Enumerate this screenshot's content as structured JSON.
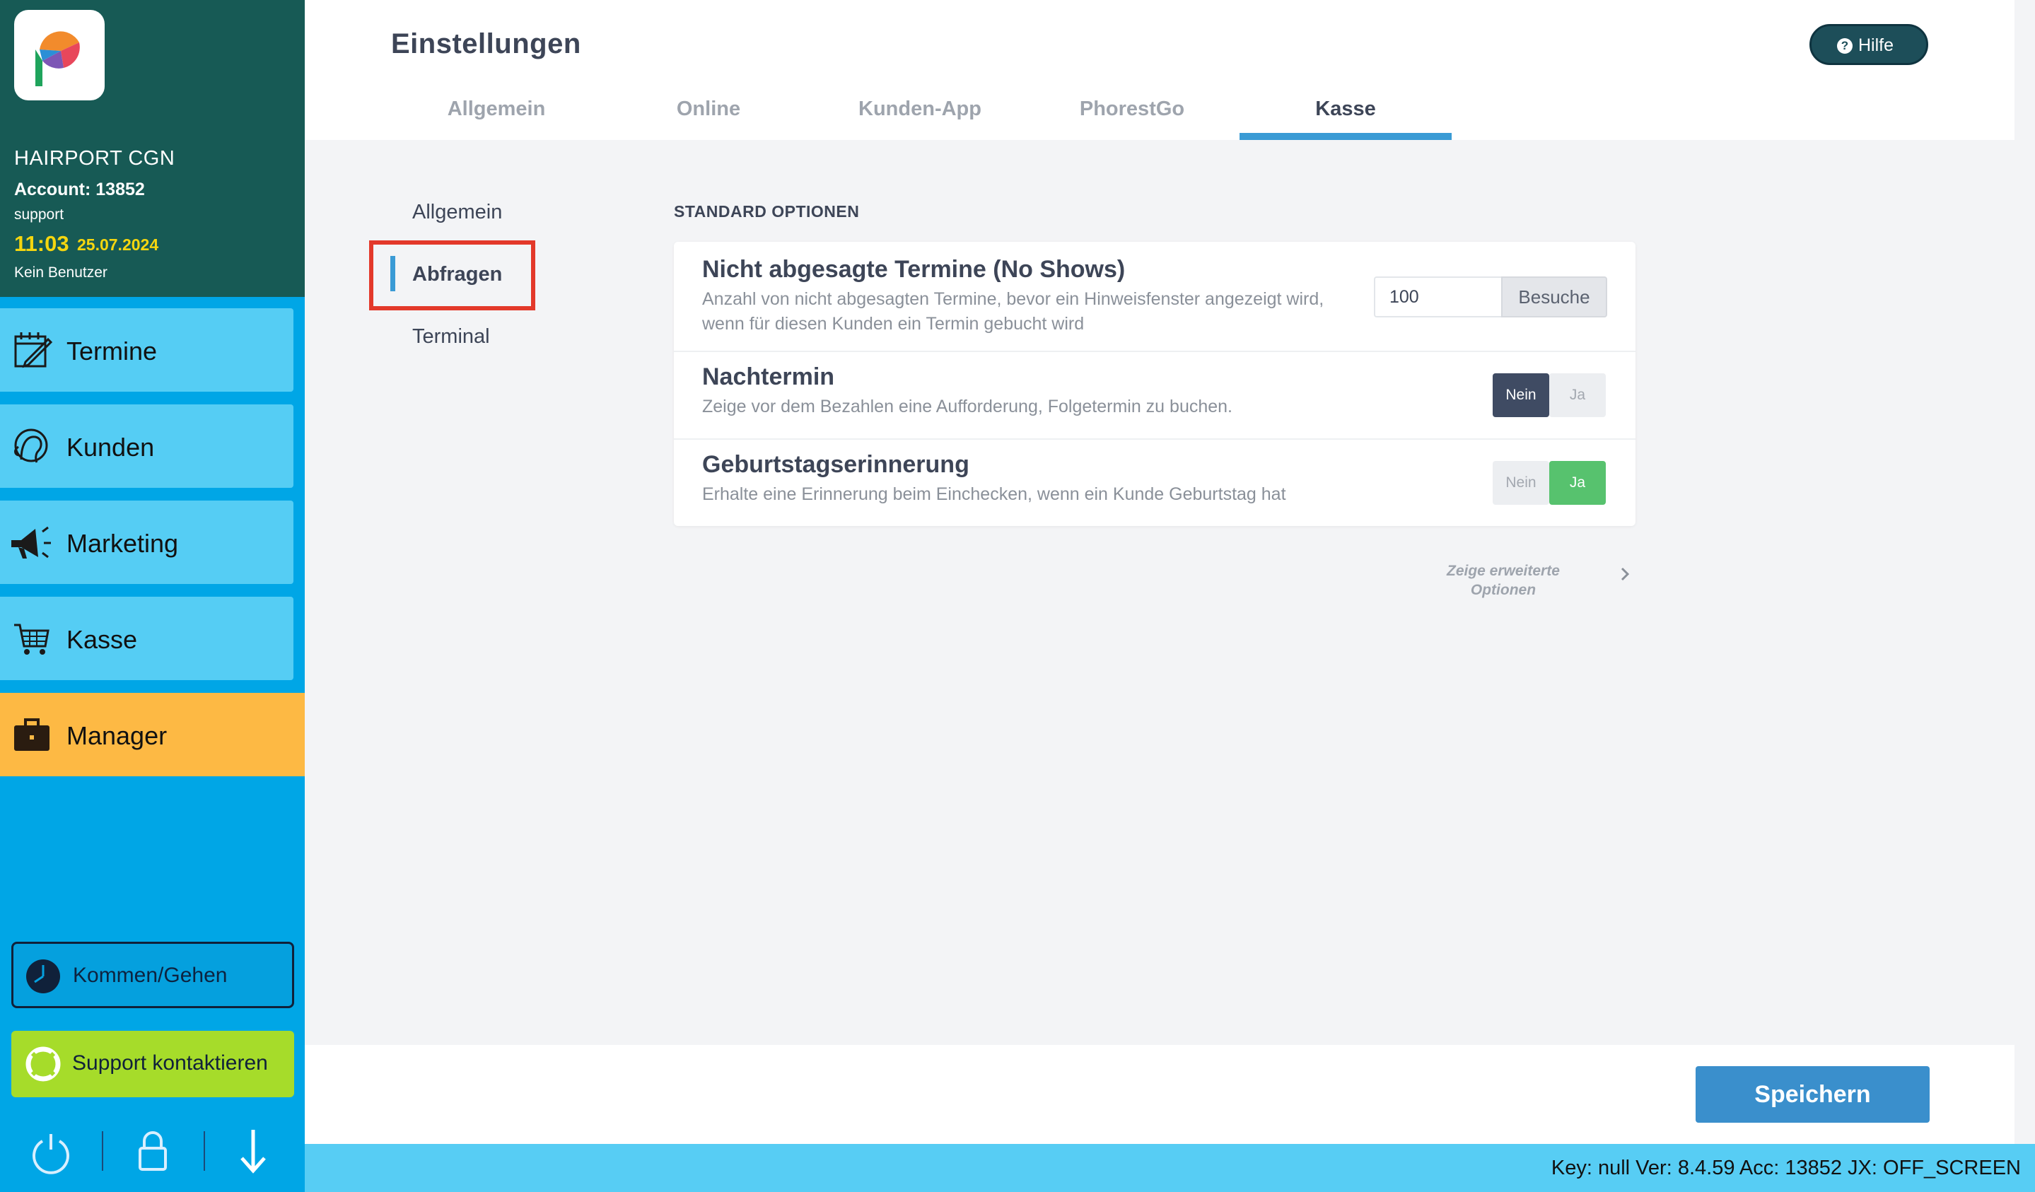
{
  "sidebar": {
    "company": "HAIRPORT CGN",
    "account": "Account: 13852",
    "user_role": "support",
    "time": "11:03",
    "date": "25.07.2024",
    "user_status": "Kein Benutzer",
    "nav": [
      {
        "label": "Termine",
        "icon": "calendar-icon"
      },
      {
        "label": "Kunden",
        "icon": "customer-head-icon"
      },
      {
        "label": "Marketing",
        "icon": "megaphone-icon"
      },
      {
        "label": "Kasse",
        "icon": "shopping-cart-icon"
      },
      {
        "label": "Manager",
        "icon": "briefcase-icon"
      }
    ],
    "kommen_gehen": "Kommen/Gehen",
    "support": "Support kontaktieren",
    "colors": {
      "header": "#175a55",
      "nav": "#55cdf4",
      "manager": "#fdb944",
      "time": "#f5d60f"
    }
  },
  "header": {
    "title": "Einstellungen",
    "help": "Hilfe",
    "tabs": [
      "Allgemein",
      "Online",
      "Kunden-App",
      "PhorestGo",
      "Kasse"
    ],
    "active_tab": "Kasse"
  },
  "subnav": {
    "items": [
      "Allgemein",
      "Abfragen",
      "Terminal"
    ],
    "active": "Abfragen"
  },
  "options": {
    "section_title": "STANDARD OPTIONEN",
    "no_shows": {
      "title": "Nicht abgesagte Termine (No Shows)",
      "description": "Anzahl von nicht abgesagten Termine, bevor ein Hinweisfenster angezeigt wird, wenn für diesen Kunden ein Termin gebucht wird",
      "value": "100",
      "unit": "Besuche"
    },
    "nachtermin": {
      "title": "Nachtermin",
      "description": "Zeige vor dem Bezahlen eine Aufforderung, Folgetermin zu buchen.",
      "no": "Nein",
      "yes": "Ja",
      "selected": "Nein"
    },
    "geburtstag": {
      "title": "Geburtstagserinnerung",
      "description": "Erhalte eine Erinnerung beim Einchecken, wenn ein Kunde Geburtstag hat",
      "no": "Nein",
      "yes": "Ja",
      "selected": "Ja"
    },
    "advanced_line1": "Zeige erweiterte",
    "advanced_line2": "Optionen"
  },
  "footer": {
    "save": "Speichern",
    "status": "Key: null Ver: 8.4.59 Acc: 13852  JX: OFF_SCREEN"
  }
}
